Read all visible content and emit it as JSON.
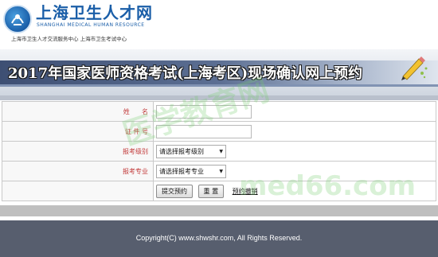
{
  "header": {
    "logo_title": "上海卫生人才网",
    "logo_en": "SHANGHAI MEDICAL HUMAN RESOURCE",
    "logo_sub": "上海市卫生人才交流服务中心   上海市卫生考试中心"
  },
  "banner": {
    "title": "2017年国家医师资格考试(上海考区)现场确认网上预约"
  },
  "form": {
    "name_label": "姓      名",
    "name_value": "",
    "id_label": "证 件 号",
    "id_value": "",
    "level_label": "报考级别",
    "level_selected": "请选择报考级别",
    "major_label": "报考专业",
    "major_selected": "请选择报考专业",
    "submit_label": "提交预约",
    "reset_label": "重 置",
    "cancel_link": "预约撤销"
  },
  "watermark": {
    "line1": "医学教育网",
    "line2": "med66.com"
  },
  "footer": {
    "copyright": "Copyright(C) www.shwshr.com, All Rights Reserved."
  },
  "colors": {
    "brand_blue": "#1a5ea8",
    "label_red": "#c23a3a",
    "footer_bg": "#575e6e"
  }
}
